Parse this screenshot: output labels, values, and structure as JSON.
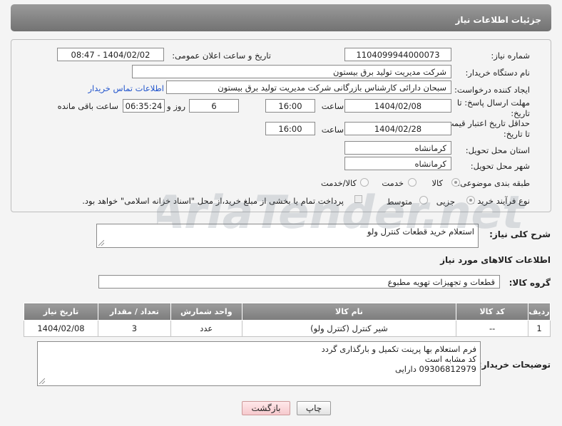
{
  "header": {
    "title": "جزئیات اطلاعات نیاز"
  },
  "form": {
    "need_number_label": "شماره نیاز:",
    "need_number": "1104099944000073",
    "announce_label": "تاریخ و ساعت اعلان عمومی:",
    "announce_value": "1404/02/02 - 08:47",
    "buyer_org_label": "نام دستگاه خریدار:",
    "buyer_org": "شرکت مدیریت تولید برق بیستون",
    "creator_label": "ایجاد کننده درخواست:",
    "creator": "سبحان دارائی کارشناس بازرگانی شرکت مدیریت تولید برق بیستون",
    "contact_link": "اطلاعات تماس خریدار",
    "deadline_label_1": "مهلت ارسال پاسخ: تا",
    "deadline_label_2": "تاریخ:",
    "deadline_date": "1404/02/08",
    "time_label": "ساعت",
    "deadline_time": "16:00",
    "days_value": "6",
    "days_label": "روز و",
    "remaining_time": "06:35:24",
    "remaining_label": "ساعت باقی مانده",
    "validity_label_1": "حداقل تاریخ اعتبار قیمت:",
    "validity_label_2": "تا تاریخ:",
    "validity_date": "1404/02/28",
    "validity_time_label": "ساعت",
    "validity_time": "16:00",
    "province_label": "استان محل تحویل:",
    "province": "کرمانشاه",
    "city_label": "شهر محل تحویل:",
    "city": "کرمانشاه",
    "category_label": "طبقه بندی موضوعی:",
    "category_options": [
      "کالا",
      "خدمت",
      "کالا/خدمت"
    ],
    "category_selected": "کالا",
    "process_label": "نوع فرآیند خرید :",
    "process_options": [
      "جزیی",
      "متوسط"
    ],
    "process_selected": "جزیی",
    "payment_note": "پرداخت تمام یا بخشی از مبلغ خرید،از محل \"اسناد خزانه اسلامی\" خواهد بود."
  },
  "description": {
    "label": "شرح کلی نیاز:",
    "value": "استعلام خرید قطعات کنترل ولو"
  },
  "goods_section": {
    "title": "اطلاعات کالاهای مورد نیاز",
    "group_label": "گروه کالا:",
    "group_value": "قطعات و تجهیزات تهویه مطبوع"
  },
  "table": {
    "headers": [
      "ردیف",
      "کد کالا",
      "نام کالا",
      "واحد شمارش",
      "تعداد / مقدار",
      "تاریخ نیاز"
    ],
    "rows": [
      {
        "index": "1",
        "code": "--",
        "name": "شیر کنترل (کنترل ولو)",
        "unit": "عدد",
        "qty": "3",
        "date": "1404/02/08"
      }
    ]
  },
  "buyer_notes": {
    "label": "توضیحات خریدار:",
    "lines": [
      "فرم استعلام بها پرینت تکمیل و بارگذاری گردد",
      "کد مشابه است",
      "09306812979 دارایی"
    ]
  },
  "buttons": {
    "print": "چاپ",
    "back": "بازگشت"
  },
  "watermark": {
    "text": "AriaTender.net"
  },
  "colors": {
    "header_bg": "#8a8a8a",
    "link": "#2255cc",
    "back_button": "#f6c9cd"
  }
}
